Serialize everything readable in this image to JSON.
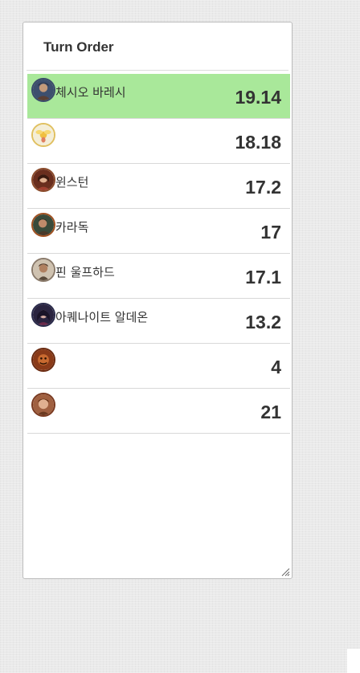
{
  "panel": {
    "title": "Turn Order"
  },
  "turn_order": [
    {
      "name": "체시오 바레시",
      "initiative": "19.14",
      "active": true,
      "icon": "character-portrait-icon"
    },
    {
      "name": "",
      "initiative": "18.18",
      "active": false,
      "icon": "fairy-portrait-icon"
    },
    {
      "name": "윈스턴",
      "initiative": "17.2",
      "active": false,
      "icon": "character-portrait-icon"
    },
    {
      "name": "카라독",
      "initiative": "17",
      "active": false,
      "icon": "character-portrait-icon"
    },
    {
      "name": "핀 울프하드",
      "initiative": "17.1",
      "active": false,
      "icon": "character-portrait-icon"
    },
    {
      "name": "아퀘나이트 알데온",
      "initiative": "13.2",
      "active": false,
      "icon": "character-portrait-icon"
    },
    {
      "name": "",
      "initiative": "4",
      "active": false,
      "icon": "monster-portrait-icon"
    },
    {
      "name": "",
      "initiative": "21",
      "active": false,
      "icon": "monster-portrait-icon"
    }
  ],
  "colors": {
    "active_row": "#a9e89a",
    "text": "#333333",
    "divider": "#d8d8d8"
  }
}
